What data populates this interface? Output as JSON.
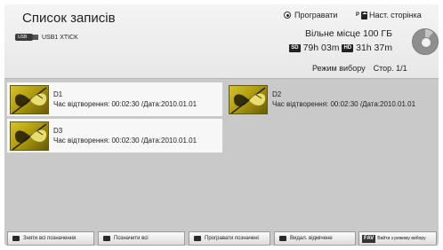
{
  "header": {
    "title": "Список записів",
    "device_icon_text": "USB",
    "device_name": "USB1 XTICK",
    "play_option": "Програвати",
    "page_key": "P",
    "next_page": "Наст. сторінка",
    "free_space": "Вільне місце 100 ГБ",
    "sd_badge": "SD",
    "sd_time": "79h 03m",
    "hd_badge": "HD",
    "hd_time": "31h 37m",
    "mode": "Режим вибору",
    "page": "Стор. 1/1"
  },
  "items": [
    {
      "name": "D1",
      "meta": "Час відтворення: 00:02:30 /Дата:2010.01.01",
      "selected": true
    },
    {
      "name": "D2",
      "meta": "Час відтворення: 00:02:30 /Дата:2010.01.01",
      "selected": false
    },
    {
      "name": "D3",
      "meta": "Час відтворення: 00:02:30 /Дата:2010.01.01",
      "selected": true
    }
  ],
  "buttons": {
    "unmark_all": "Зняти всі позначення",
    "mark_all": "Позначити всі",
    "play_marked": "Програвати позначені",
    "delete_marked": "Видал. відмічене",
    "fav_key": "FAV",
    "exit_mode": "Вийти з режиму вибору"
  },
  "colors": {
    "header_bg": "#eeeeee",
    "screen_bg": "#c9c9c9",
    "selected_bg": "#f7f7f7",
    "thumb_yellow": "#d7c22a"
  },
  "icons": [
    "usb-icon",
    "radio-icon",
    "page-icon",
    "disk-usage-icon",
    "butterfly-thumbnail-icon"
  ]
}
